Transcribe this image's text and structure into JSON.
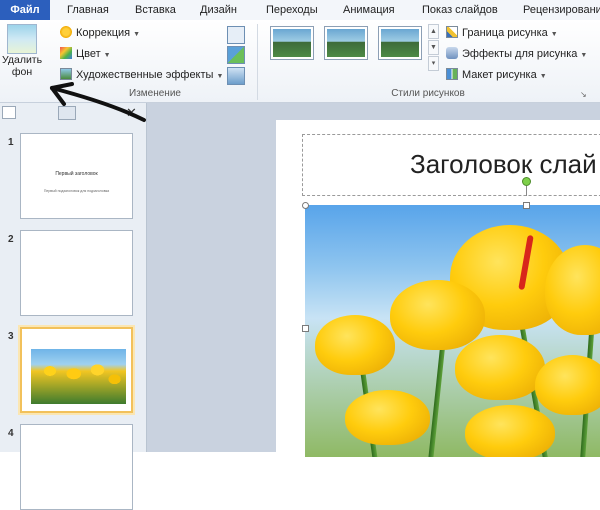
{
  "tabs": [
    "Файл",
    "Главная",
    "Вставка",
    "Дизайн",
    "Переходы",
    "Анимация",
    "Показ слайдов",
    "Рецензирование"
  ],
  "ribbon": {
    "remove_bg": {
      "line1": "Удалить",
      "line2": "фон"
    },
    "adjust": {
      "correction": "Коррекция",
      "color": "Цвет",
      "artistic": "Художественные эффекты",
      "group_label": "Изменение"
    },
    "styles": {
      "group_label": "Стили рисунков",
      "border": "Граница рисунка",
      "effects": "Эффекты для рисунка",
      "layout": "Макет рисунка"
    }
  },
  "slides": [
    {
      "number": "1",
      "title": "Первый заголовок",
      "subtitle": "Первый подзаголовок для подзаголовка"
    },
    {
      "number": "2"
    },
    {
      "number": "3"
    },
    {
      "number": "4"
    }
  ],
  "main": {
    "title": "Заголовок слай"
  },
  "colors": {
    "file_tab": "#2c5fbd",
    "selection": "#f2c15b",
    "rotation_handle": "#7ed04a"
  }
}
